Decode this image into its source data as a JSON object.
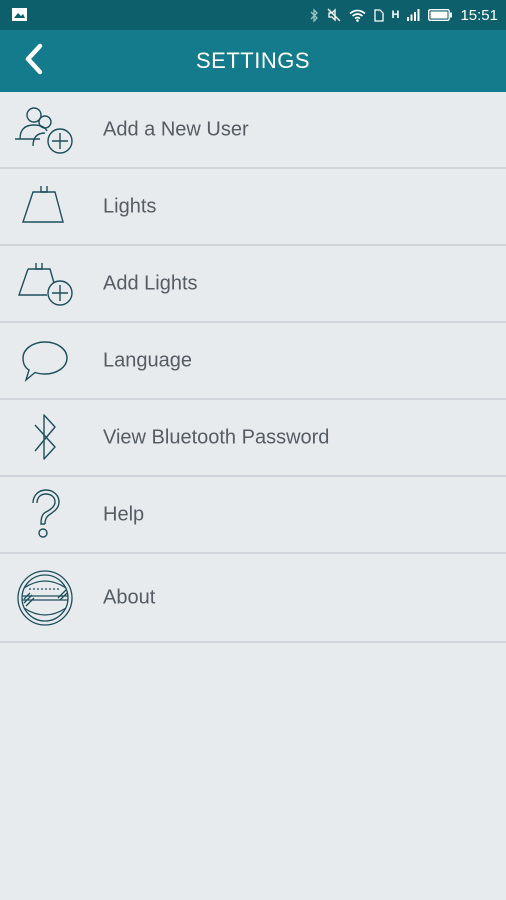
{
  "status_bar": {
    "network_type": "H",
    "time": "15:51"
  },
  "app_bar": {
    "title": "SETTINGS",
    "back_icon": "chevron-left-icon"
  },
  "menu": {
    "items": [
      {
        "label": "Add a New User",
        "icon": "add-user-icon"
      },
      {
        "label": "Lights",
        "icon": "light-icon"
      },
      {
        "label": "Add Lights",
        "icon": "add-light-icon"
      },
      {
        "label": "Language",
        "icon": "speech-bubble-icon"
      },
      {
        "label": "View Bluetooth Password",
        "icon": "bluetooth-icon"
      },
      {
        "label": "Help",
        "icon": "question-mark-icon"
      },
      {
        "label": "About",
        "icon": "spectrum-logo-icon"
      }
    ]
  },
  "colors": {
    "status_bar": "#0e5f6c",
    "app_bar": "#137b8b",
    "background": "#e8ebee",
    "divider": "#cfd5db",
    "label_text": "#555c63"
  }
}
